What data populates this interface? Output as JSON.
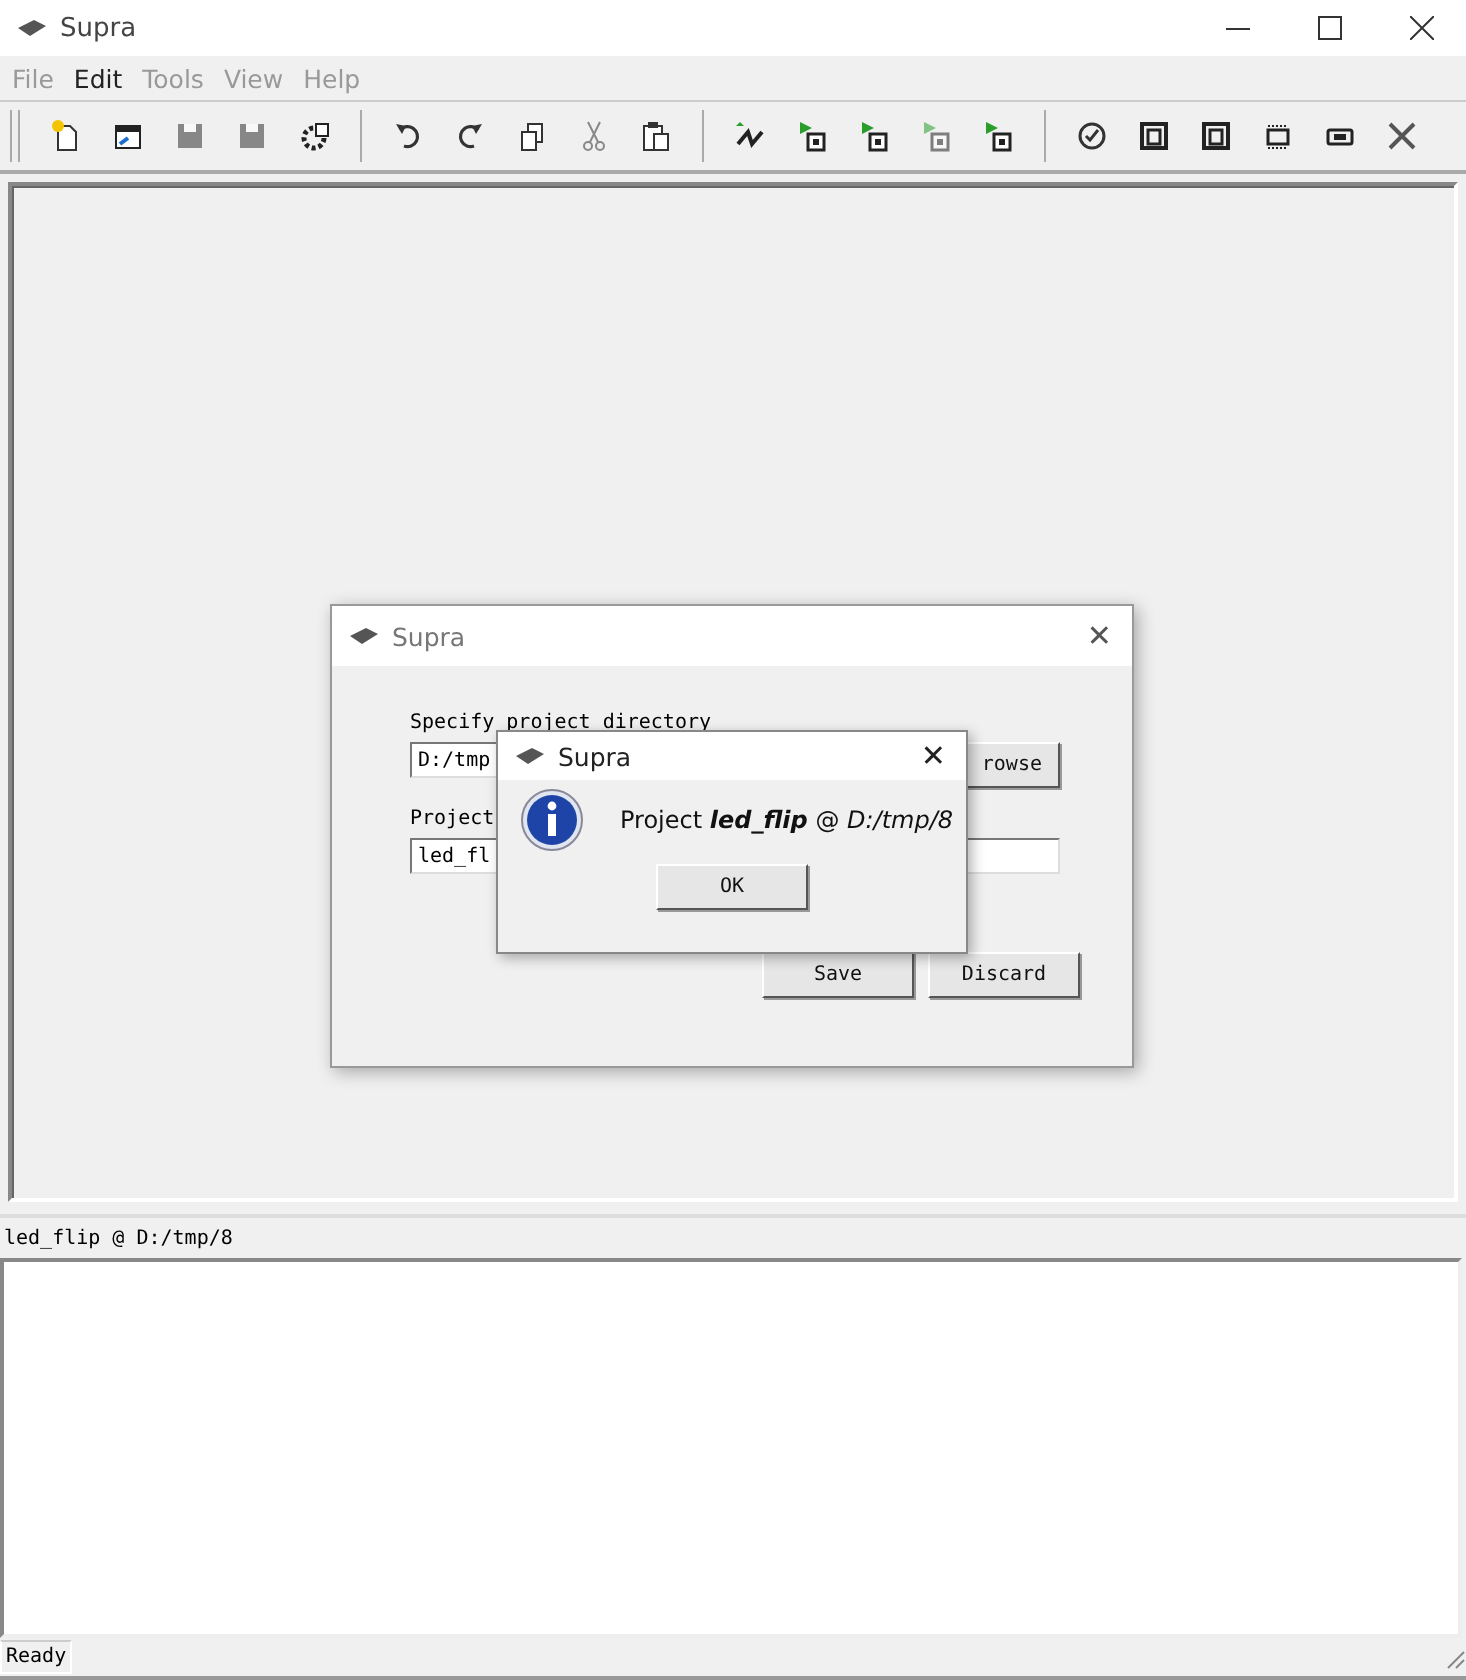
{
  "window": {
    "title": "Supra"
  },
  "menu": [
    {
      "label": "File",
      "disabled": true
    },
    {
      "label": "Edit",
      "disabled": false
    },
    {
      "label": "Tools",
      "disabled": true
    },
    {
      "label": "View",
      "disabled": true
    },
    {
      "label": "Help",
      "disabled": true
    }
  ],
  "project_dialog": {
    "title": "Supra",
    "close": "✕",
    "directory_label": "Specify project directory",
    "directory_value": "D:/tmp",
    "browse_button": "rowse",
    "name_label": "Project",
    "name_value": "led_fl",
    "buttons": [
      "Save",
      "Discard"
    ]
  },
  "message_box": {
    "title": "Supra",
    "close": "✕",
    "message": "Project **led_flip** @ *D:/tmp/8*",
    "button": "OK"
  },
  "output_panel": {
    "title": "led_flip @ D:/tmp/8"
  },
  "status_bar": {
    "text": "Ready"
  }
}
